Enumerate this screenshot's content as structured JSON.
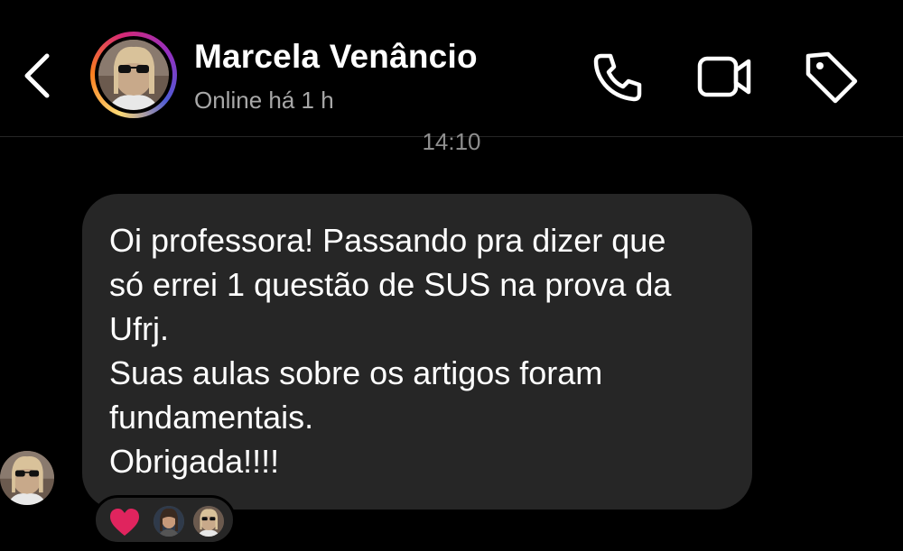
{
  "header": {
    "contact_name": "Marcela Venâncio",
    "status": "Online há 1 h",
    "icons": [
      "back-icon",
      "phone-icon",
      "video-camera-icon",
      "tag-icon"
    ]
  },
  "thread": {
    "timestamp": "14:10",
    "message": {
      "text": "Oi professora! Passando pra dizer que\nsó errei 1 questão de SUS na prova da\nUfrj.\nSuas aulas sobre os artigos foram\nfundamentais.\nObrigada!!!!"
    },
    "reactions": {
      "emoji": "heart",
      "avatars": 2
    }
  },
  "colors": {
    "background": "#000000",
    "bubble": "#262626",
    "secondary_text": "#a8a8a8",
    "heart": "#e0245e"
  }
}
